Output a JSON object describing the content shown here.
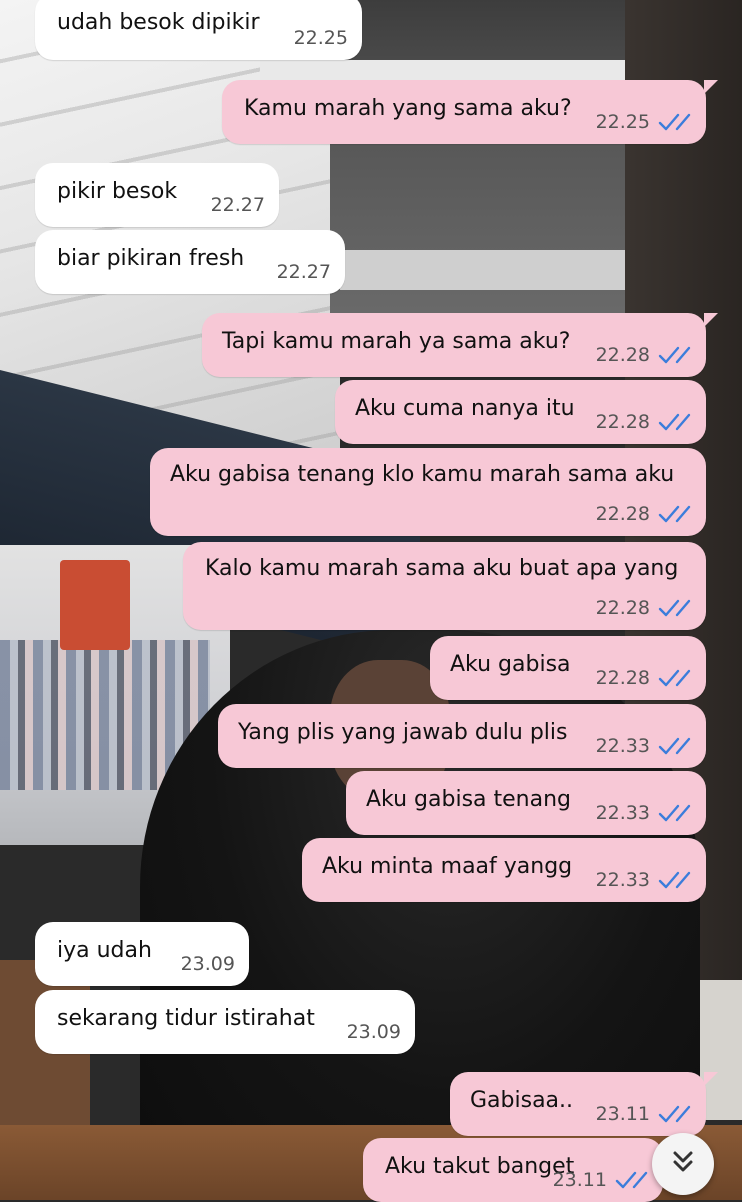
{
  "messages": [
    {
      "dir": "in",
      "text": "udah besok dipikir",
      "time": "22.25"
    },
    {
      "dir": "out",
      "text": "Kamu marah yang sama aku?",
      "time": "22.25"
    },
    {
      "dir": "in",
      "text": "pikir besok",
      "time": "22.27"
    },
    {
      "dir": "in",
      "text": "biar pikiran fresh",
      "time": "22.27"
    },
    {
      "dir": "out",
      "text": "Tapi kamu marah ya sama aku?",
      "time": "22.28"
    },
    {
      "dir": "out",
      "text": "Aku cuma nanya itu",
      "time": "22.28"
    },
    {
      "dir": "out",
      "text": "Aku gabisa tenang klo kamu marah sama aku",
      "time": "22.28"
    },
    {
      "dir": "out",
      "text": "Kalo kamu marah sama aku buat apa yang",
      "time": "22.28"
    },
    {
      "dir": "out",
      "text": "Aku gabisa",
      "time": "22.28"
    },
    {
      "dir": "out",
      "text": "Yang plis yang jawab dulu plis",
      "time": "22.33"
    },
    {
      "dir": "out",
      "text": "Aku gabisa tenang",
      "time": "22.33"
    },
    {
      "dir": "out",
      "text": "Aku minta maaf yangg",
      "time": "22.33"
    },
    {
      "dir": "in",
      "text": "iya udah",
      "time": "23.09"
    },
    {
      "dir": "in",
      "text": "sekarang tidur istirahat",
      "time": "23.09"
    },
    {
      "dir": "out",
      "text": "Gabisaa..",
      "time": "23.11"
    },
    {
      "dir": "out",
      "text": "Aku takut banget",
      "time": "23.11"
    }
  ],
  "icons": {
    "read_receipt": "double-check-icon",
    "scroll_down": "chevron-double-down-icon"
  },
  "colors": {
    "incoming_bubble": "#ffffff",
    "outgoing_bubble": "#f7c8d6",
    "read_tick": "#3b7ddb"
  }
}
